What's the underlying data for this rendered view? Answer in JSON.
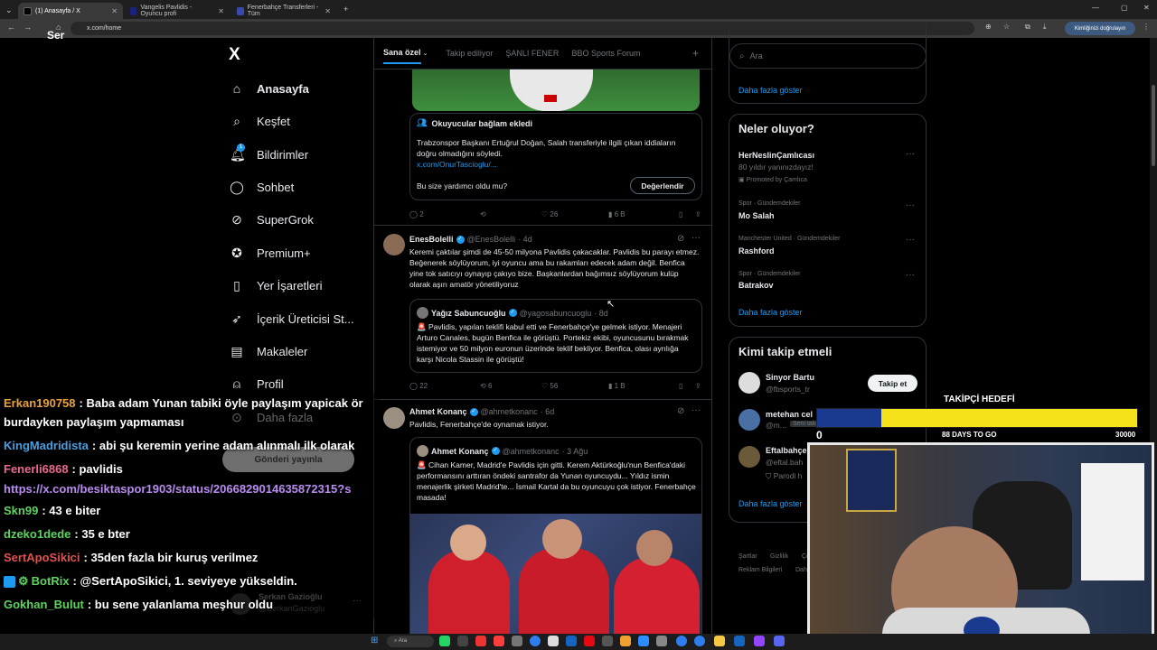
{
  "browser": {
    "tabs": [
      {
        "label": "(1) Anasayfa / X",
        "close": "✕"
      },
      {
        "label": "Vangelis Pavlidis - Oyuncu profi",
        "close": "✕"
      },
      {
        "label": "Fenerbahçe Transferleri - Tüm",
        "close": "✕"
      }
    ],
    "new_tab": "+",
    "url": "x.com/home",
    "overlay_text": "Ser",
    "verify_label": "Kimliğinizi doğrulayın"
  },
  "nav": {
    "logo": "X",
    "items": [
      {
        "label": "Anasayfa",
        "icon": "home-icon"
      },
      {
        "label": "Keşfet",
        "icon": "search-icon"
      },
      {
        "label": "Bildirimler",
        "icon": "bell-icon",
        "badge": "1"
      },
      {
        "label": "Sohbet",
        "icon": "chat-icon"
      },
      {
        "label": "SuperGrok",
        "icon": "grok-icon"
      },
      {
        "label": "Premium+",
        "icon": "premium-icon"
      },
      {
        "label": "Yer İşaretleri",
        "icon": "bookmark-icon"
      },
      {
        "label": "İçerik Üreticisi St...",
        "icon": "rocket-icon"
      },
      {
        "label": "Makaleler",
        "icon": "articles-icon"
      },
      {
        "label": "Profil",
        "icon": "profile-icon"
      },
      {
        "label": "Daha fazla",
        "icon": "more-icon"
      }
    ],
    "post_button": "Gönderi yayınla",
    "account": {
      "name": "Serkan Gazioğlu",
      "handle": "@SerkanGazioglu"
    }
  },
  "feed": {
    "tabs": [
      "Sana özel",
      "Takip ediliyor",
      "ŞANLI FENER",
      "BBO Sports Forum"
    ],
    "add_tab": "+",
    "post1": {
      "community_note_title": "Okuyucular bağlam ekledi",
      "note_text": "Trabzonspor Başkanı Ertuğrul Doğan, Salah transferiyle ilgili çıkan iddiaların doğru olmadığını söyledi.",
      "note_link": "x.com/OnurTascioglu/...",
      "helpful_q": "Bu size yardımcı oldu mu?",
      "rate_button": "Değerlendir",
      "stats": {
        "replies": "2",
        "retweets": "",
        "likes": "26",
        "views": "6 B"
      }
    },
    "post2": {
      "name": "EnesBolelli",
      "handle": "@EnesBolelli",
      "time": "· 4d",
      "text": "Keremi çaktılar şimdi de 45-50 milyona Pavlidis çakacaklar. Pavlidis bu parayı etmez. Beğenerek söylüyorum, iyi oyuncu ama bu rakamları edecek adam değil. Benfica yine tok satıcıyı oynayıp çakıyo bize. Başkanlardan bağımsız söylüyorum kulüp olarak aşırı amatör yönetiliyoruz",
      "quote": {
        "name": "Yağız Sabuncuoğlu",
        "handle": "@yagosabuncuoglu",
        "time": "· 8d",
        "text": "🚨 Pavlidis, yapılan teklifi kabul etti ve Fenerbahçe'ye gelmek istiyor. Menajeri Arturo Canales, bugün Benfica ile görüştü. Portekiz ekibi, oyuncusunu bırakmak istemiyor ve 50 milyon euronun üzerinde teklif bekliyor. Benfica, olası ayrılığa karşı Nicola Stassin ile görüştü!"
      },
      "stats": {
        "replies": "22",
        "retweets": "6",
        "likes": "56",
        "views": "1 B"
      }
    },
    "post3": {
      "name": "Ahmet Konanç",
      "handle": "@ahmetkonanc",
      "time": "· 6d",
      "text": "Pavlidis, Fenerbahçe'de oynamak istiyor.",
      "quote": {
        "name": "Ahmet Konanç",
        "handle": "@ahmetkonanc",
        "time": "· 3 Ağu",
        "text": "🚨 Cihan Kamer, Madrid'e Pavlidis için gitti. Kerem Aktürkoğlu'nun Benfica'daki performansını arttıran öndeki santrafor da Yunan oyuncuydu... Yıldız ismin menajerlik şirketi Madrid'te... İsmail Kartal da bu oyuncuyu çok istiyor. Fenerbahçe masada!"
      }
    }
  },
  "right": {
    "search_placeholder": "Ara",
    "show_more": "Daha fazla göster",
    "trends_title": "Neler oluyor?",
    "trends": [
      {
        "meta": "",
        "name": "HerNeslinÇamlıcası",
        "sub": "80 yıldır yanınızdayız!",
        "promo": "Promoted by Çamlıca"
      },
      {
        "meta": "Spor · Gündemdekiler",
        "name": "Mo Salah"
      },
      {
        "meta": "Manchester United · Gündemdekiler",
        "name": "Rashford"
      },
      {
        "meta": "Spor · Gündemdekiler",
        "name": "Batrakov"
      }
    ],
    "trends_more": "Daha fazla göster",
    "follow_title": "Kimi takip etmeli",
    "follow": [
      {
        "name": "Sinyor Bartu",
        "handle": "@fbsports_tr",
        "button": "Takip et"
      },
      {
        "name": "metehan cel",
        "handle": "@m...",
        "tag": "Seni takip"
      },
      {
        "name": "Eftalbahçe",
        "handle": "@eftal.bah",
        "extra": "Parodi h"
      }
    ],
    "follow_more": "Daha fazla göster",
    "footer": [
      "Şartlar",
      "Gizlilik",
      "Çe",
      "Reklam Bilgileri",
      "Dah"
    ]
  },
  "overlay": {
    "goal_title": "TAKİPÇİ HEDEFİ",
    "goal_start": "0",
    "goal_days": "88 DAYS TO GO",
    "goal_target": "30000",
    "goal_progress": 0.2
  },
  "chat": [
    {
      "user": "Erkan190758",
      "color": "#e8a33d",
      "msg": ": Baba adam Yunan tabiki öyle paylaşım yapicak ör"
    },
    {
      "user": "",
      "color": "#ffffff",
      "msg": "burdayken paylaşım yapmaması"
    },
    {
      "user": "KingMadridista",
      "color": "#4a9fe0",
      "msg": ": abi şu keremin yerine adam alınmalı ilk olarak"
    },
    {
      "user": "Fenerli6868",
      "color": "#e86a8e",
      "msg": ": pavlidis"
    },
    {
      "user": "",
      "color": "#b98cf0",
      "msg": "https://x.com/besiktaspor1903/status/2066829014635872315?s"
    },
    {
      "user": "Skn99",
      "color": "#5fd35f",
      "msg": ": 43 e biter"
    },
    {
      "user": "dzeko1dede",
      "color": "#5fd35f",
      "msg": ": 35 e bter"
    },
    {
      "user": "SertApoSikici",
      "color": "#e05050",
      "msg": ": 35den fazla bir kuruş verilmez"
    },
    {
      "user": "BotRix",
      "color": "#5fd35f",
      "msg": ": @SertApoSikici, 1. seviyeye yükseldin."
    },
    {
      "user": "Gokhan_Bulut",
      "color": "#5fd35f",
      "msg": ": bu sene yalanlama meşhur oldu"
    }
  ]
}
